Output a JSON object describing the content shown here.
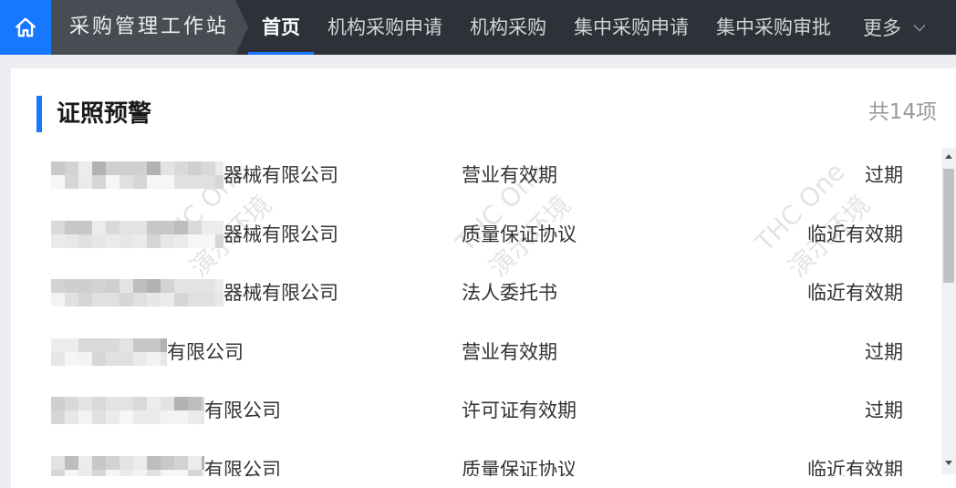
{
  "nav": {
    "home_icon": "home-icon",
    "app_title": "采购管理工作站",
    "tabs": [
      {
        "label": "首页",
        "active": true
      },
      {
        "label": "机构采购申请",
        "active": false
      },
      {
        "label": "机构采购",
        "active": false
      },
      {
        "label": "集中采购申请",
        "active": false
      },
      {
        "label": "集中采购审批",
        "active": false
      }
    ],
    "more_label": "更多",
    "more_icon": "chevron-down-icon"
  },
  "panel": {
    "title": "证照预警",
    "count_label": "共14项",
    "rows": [
      {
        "company_suffix": "器械有限公司",
        "license_type": "营业有效期",
        "status": "过期"
      },
      {
        "company_suffix": "器械有限公司",
        "license_type": "质量保证协议",
        "status": "临近有效期"
      },
      {
        "company_suffix": "器械有限公司",
        "license_type": "法人委托书",
        "status": "临近有效期"
      },
      {
        "company_suffix": "有限公司",
        "license_type": "营业有效期",
        "status": "过期"
      },
      {
        "company_suffix": "有限公司",
        "license_type": "许可证有效期",
        "status": "过期"
      },
      {
        "company_suffix": "有限公司",
        "license_type": "质量保证协议",
        "status": "临近有效期"
      }
    ]
  },
  "watermark": {
    "line1": "THC One",
    "line2": "演示环境"
  },
  "colors": {
    "accent": "#1677ff",
    "nav_background": "#2e3238"
  }
}
